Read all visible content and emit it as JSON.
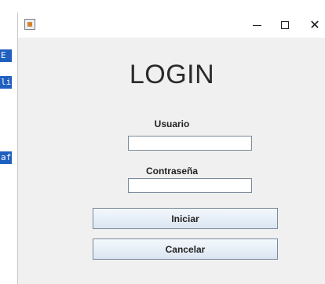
{
  "background": {
    "fragments": [
      "E",
      "li",
      "af"
    ]
  },
  "window": {
    "controls": {
      "minimize": "—",
      "maximize": "☐",
      "close": "✕"
    }
  },
  "form": {
    "title": "LOGIN",
    "user_label": "Usuario",
    "user_value": "",
    "password_label": "Contraseña",
    "password_value": "",
    "submit_label": "Iniciar",
    "cancel_label": "Cancelar"
  },
  "colors": {
    "window_bg": "#f0f0f0",
    "titlebar_bg": "#ffffff",
    "button_gradient_top": "#f4f8fd",
    "button_gradient_bottom": "#dbe5f1",
    "background_fragment": "#1f5fbf"
  }
}
